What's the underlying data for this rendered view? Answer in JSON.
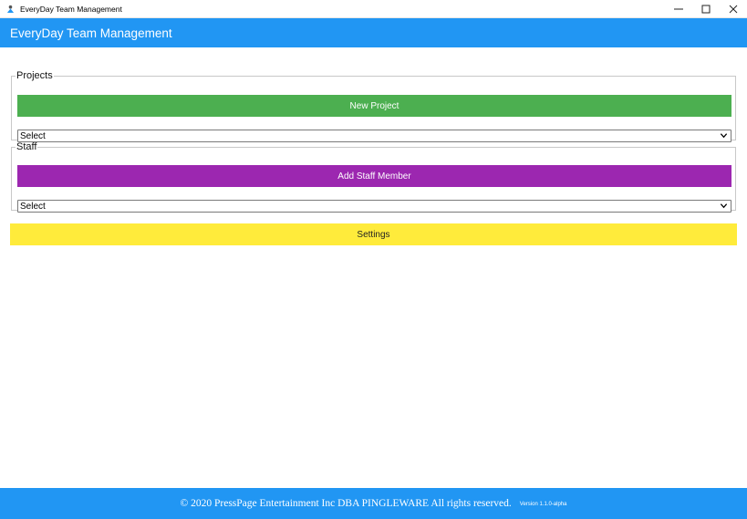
{
  "window": {
    "title": "EveryDay Team Management",
    "controls": {
      "minimize": "—",
      "maximize": "☐",
      "close": "✕"
    }
  },
  "appbar": {
    "title": "EveryDay Team Management"
  },
  "projects": {
    "legend": "Projects",
    "new_button": "New Project",
    "select_value": "Select"
  },
  "staff": {
    "legend": "Staff",
    "add_button": "Add Staff Member",
    "select_value": "Select"
  },
  "settings_button": "Settings",
  "footer": {
    "copyright": "© 2020 PressPage Entertainment Inc DBA PINGLEWARE  All rights reserved.",
    "version": "Version 1.1.0-alpha"
  },
  "colors": {
    "appbar": "#2196f3",
    "new_project": "#4caf50",
    "add_staff": "#9c27b0",
    "settings": "#ffeb3b"
  }
}
